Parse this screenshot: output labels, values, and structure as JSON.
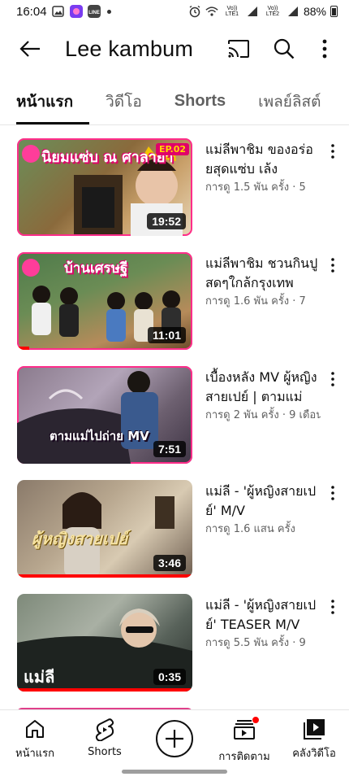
{
  "status_bar": {
    "time": "16:04",
    "battery": "88%",
    "lte1": "Vo)) LTE1",
    "lte2": "Vo)) LTE2"
  },
  "header": {
    "title": "Lee kambum"
  },
  "tabs": [
    {
      "label": "หน้าแรก",
      "active": true
    },
    {
      "label": "วิดีโอ"
    },
    {
      "label": "Shorts"
    },
    {
      "label": "เพลย์ลิสต์"
    }
  ],
  "videos": [
    {
      "title": "แม่ลีพาชิม ของอร่อยสุดแซ่บ เล้ง",
      "meta": "การดู 1.5 พัน ครั้ง · 5",
      "duration": "19:52",
      "progress": 0,
      "thumb_text": "นิยมแซ่บ ณ ศาลายา",
      "thumb_badge": "EP.02"
    },
    {
      "title": "แม่ลีพาชิม ชวนกินปูสดๆใกล้กรุงเทพ",
      "meta": "การดู 1.6 พัน ครั้ง · 7",
      "duration": "11:01",
      "progress": 0.07,
      "thumb_text": "บ้านเศรษฐี"
    },
    {
      "title": "เบื้องหลัง MV ผู้หญิงสายเปย์ | ตามแม่",
      "meta": "การดู 2 พัน ครั้ง · 9 เดือน",
      "duration": "7:51",
      "progress": 0,
      "thumb_text": "ตามแม่ไปถ่าย MV"
    },
    {
      "title": "แม่ลี - 'ผู้หญิงสายเปย์' M/V",
      "meta": "การดู 1.6 แสน ครั้ง",
      "duration": "3:46",
      "progress": 1.0,
      "thumb_text": "ผู้หญิงสายเปย์"
    },
    {
      "title": "แม่ลี - 'ผู้หญิงสายเปย์' TEASER M/V",
      "meta": "การดู 5.5 พัน ครั้ง · 9",
      "duration": "0:35",
      "progress": 1.0,
      "thumb_text": "แม่ลี"
    }
  ],
  "bottom_nav": [
    {
      "label": "หน้าแรก",
      "icon": "home-icon"
    },
    {
      "label": "Shorts",
      "icon": "shorts-icon"
    },
    {
      "label": "",
      "icon": "create-icon"
    },
    {
      "label": "การติดตาม",
      "icon": "subscriptions-icon"
    },
    {
      "label": "คลังวิดีโอ",
      "icon": "library-icon"
    }
  ],
  "colors": {
    "accent": "#ff0000",
    "text": "#0f0f0f",
    "secondary": "#606060"
  }
}
